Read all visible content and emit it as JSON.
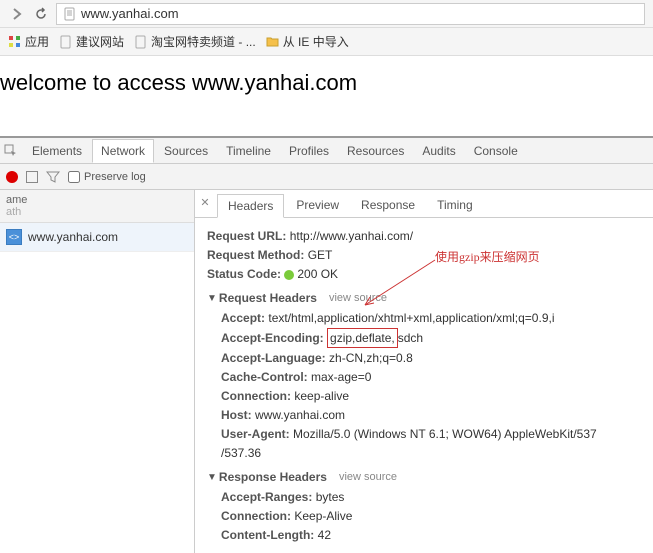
{
  "browser": {
    "url": "www.yanhai.com"
  },
  "bookmarks": {
    "apps": "应用",
    "suggest": "建议网站",
    "taobao": "淘宝网特卖频道 - ...",
    "ie_import": "从 IE 中导入"
  },
  "page": {
    "welcome": "welcome to access www.yanhai.com"
  },
  "devtools": {
    "tabs": {
      "elements": "Elements",
      "network": "Network",
      "sources": "Sources",
      "timeline": "Timeline",
      "profiles": "Profiles",
      "resources": "Resources",
      "audits": "Audits",
      "console": "Console"
    },
    "preserve_label": "Preserve log",
    "request_list": {
      "header_name": "ame",
      "header_path": "ath",
      "item1": "www.yanhai.com"
    },
    "detail_tabs": {
      "headers": "Headers",
      "preview": "Preview",
      "response": "Response",
      "timing": "Timing"
    },
    "general": {
      "url_key": "Request URL:",
      "url_val": "http://www.yanhai.com/",
      "method_key": "Request Method:",
      "method_val": "GET",
      "status_key": "Status Code:",
      "status_val": "200 OK"
    },
    "sections": {
      "request_headers": "Request Headers",
      "response_headers": "Response Headers",
      "view_source": "view source"
    },
    "req_headers": {
      "accept_key": "Accept:",
      "accept_val": "text/html,application/xhtml+xml,application/xml;q=0.9,i",
      "accept_encoding_key": "Accept-Encoding:",
      "accept_encoding_highlight": "gzip,deflate,",
      "accept_encoding_rest": "sdch",
      "accept_lang_key": "Accept-Language:",
      "accept_lang_val": "zh-CN,zh;q=0.8",
      "cache_key": "Cache-Control:",
      "cache_val": "max-age=0",
      "conn_key": "Connection:",
      "conn_val": "keep-alive",
      "host_key": "Host:",
      "host_val": "www.yanhai.com",
      "ua_key": "User-Agent:",
      "ua_val": "Mozilla/5.0 (Windows NT 6.1; WOW64) AppleWebKit/537",
      "ua_val2": "/537.36"
    },
    "resp_headers": {
      "ranges_key": "Accept-Ranges:",
      "ranges_val": "bytes",
      "conn_key": "Connection:",
      "conn_val": "Keep-Alive",
      "len_key": "Content-Length:",
      "len_val": "42"
    },
    "annotation": "使用gzip来压缩网页"
  }
}
